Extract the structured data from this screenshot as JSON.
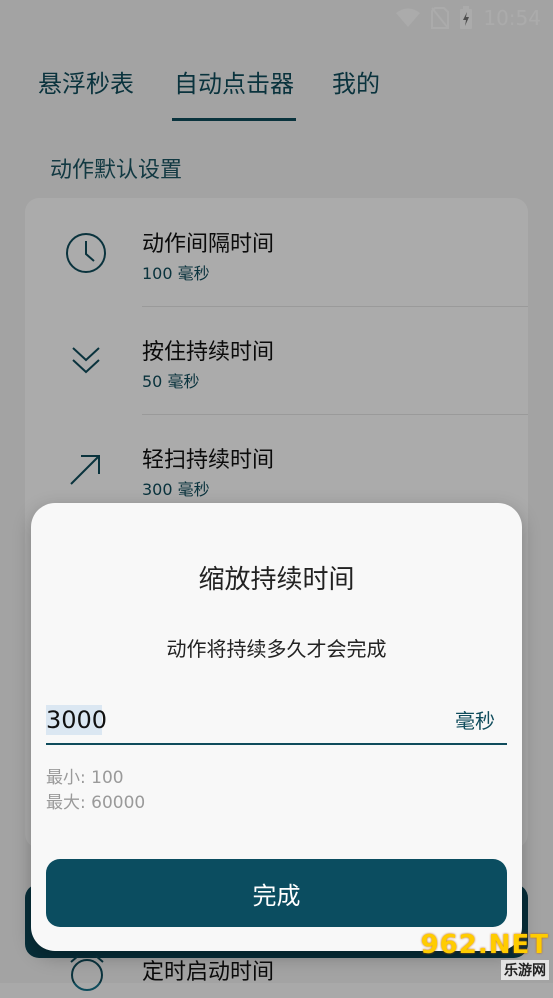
{
  "status_bar": {
    "time": "10:54",
    "icons": [
      "wifi-icon",
      "no-sim-icon",
      "battery-charging-icon"
    ]
  },
  "tabs": [
    {
      "label": "悬浮秒表"
    },
    {
      "label": "自动点击器"
    },
    {
      "label": "我的"
    }
  ],
  "active_tab": "自动点击器",
  "section_title": "动作默认设置",
  "settings": [
    {
      "title": "动作间隔时间",
      "value": "100 毫秒",
      "icon": "clock-icon"
    },
    {
      "title": "按住持续时间",
      "value": "50 毫秒",
      "icon": "double-chevron-down-icon"
    },
    {
      "title": "轻扫持续时间",
      "value": "300 毫秒",
      "icon": "arrow-up-right-icon"
    }
  ],
  "below_dialog_row": {
    "title": "定时启动时间",
    "icon": "alarm-clock-icon"
  },
  "dialog": {
    "title": "缩放持续时间",
    "description": "动作将持续多久才会完成",
    "input_value": "3000",
    "unit": "毫秒",
    "min_label": "最小: 100",
    "max_label": "最大: 60000",
    "done_label": "完成"
  },
  "watermark": {
    "top": "962.NET",
    "bottom": "乐游网"
  },
  "colors": {
    "accent": "#0f4c5c",
    "button": "#0b4d60",
    "background": "#f4f4f4"
  }
}
